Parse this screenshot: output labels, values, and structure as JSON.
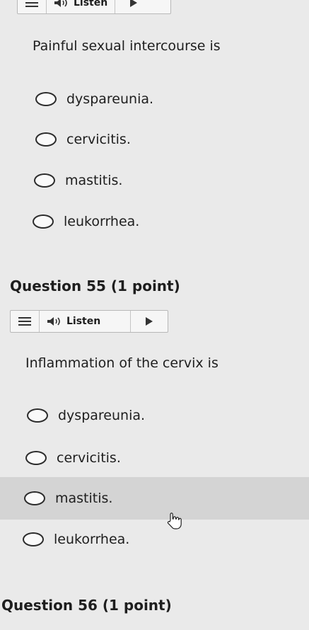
{
  "question54": {
    "listen_label": "Listen",
    "prompt": "Painful sexual intercourse is",
    "options": [
      "dyspareunia.",
      "cervicitis.",
      "mastitis.",
      "leukorrhea."
    ]
  },
  "question55": {
    "heading": "Question 55 (1 point)",
    "listen_label": "Listen",
    "prompt": "Inflammation of the cervix is",
    "options": [
      "dyspareunia.",
      "cervicitis.",
      "mastitis.",
      "leukorrhea."
    ]
  },
  "question56": {
    "heading": "Question 56 (1 point)"
  }
}
